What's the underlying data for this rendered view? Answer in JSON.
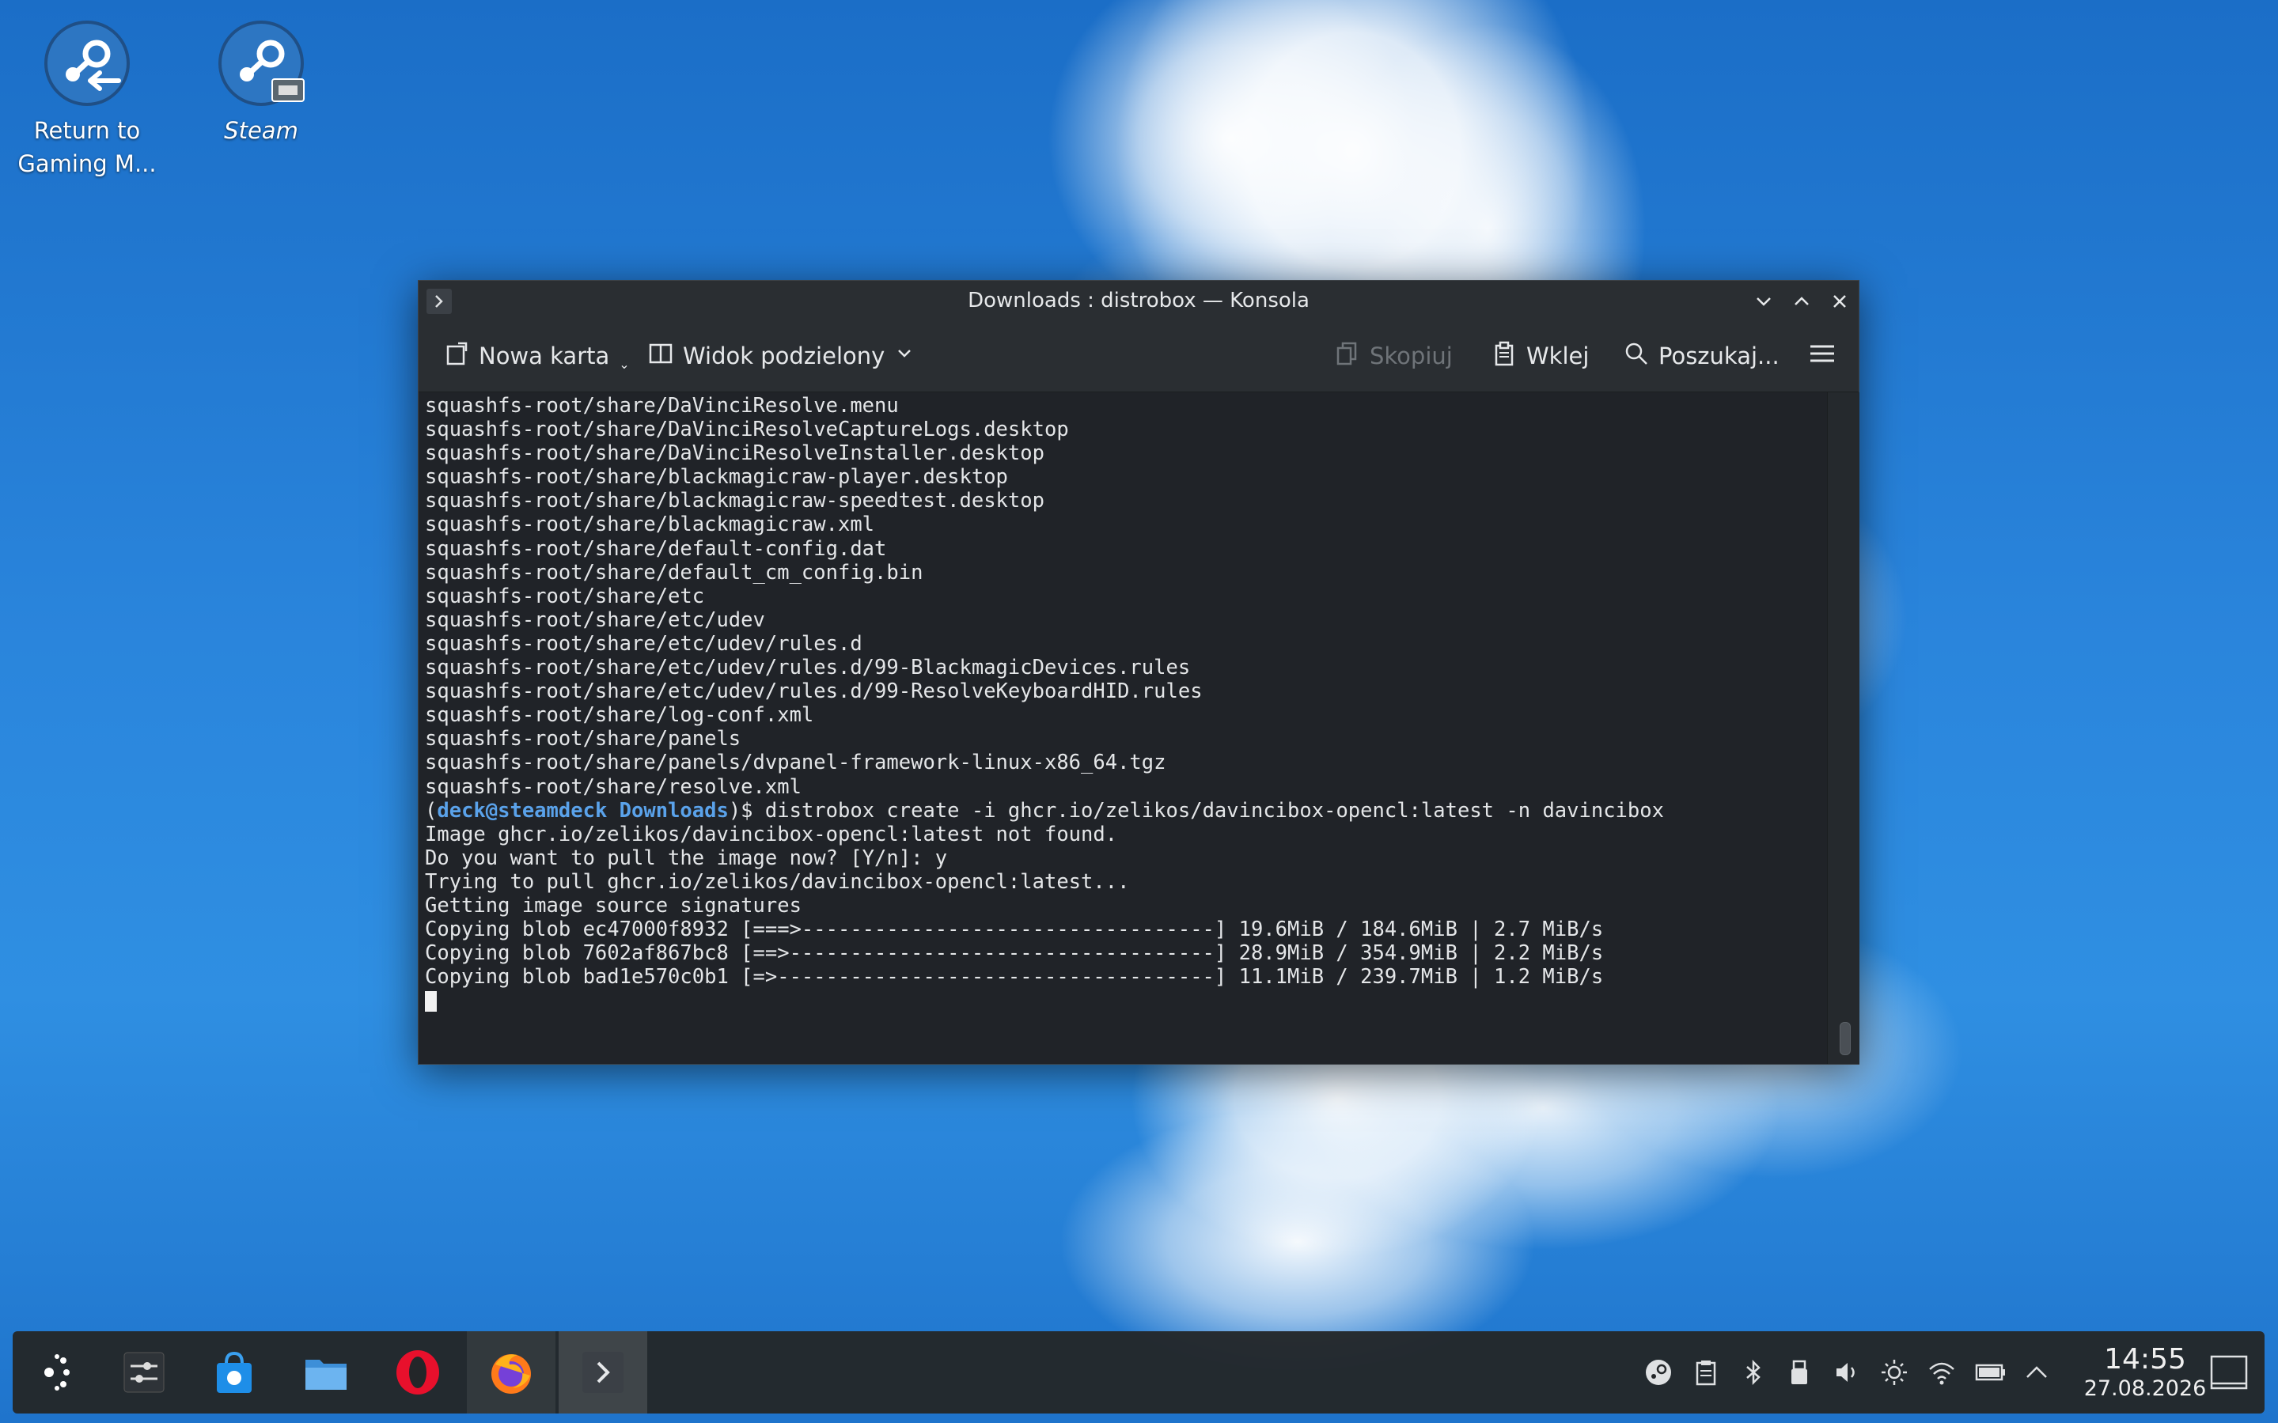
{
  "desktop": {
    "icons": [
      {
        "label": "Return to\nGaming M..."
      },
      {
        "label": "Steam"
      }
    ]
  },
  "window": {
    "title": "Downloads : distrobox — Konsola",
    "toolbar": {
      "new_tab": "Nowa karta",
      "split_view": "Widok podzielony",
      "copy": "Skopiuj",
      "paste": "Wklej",
      "search": "Poszukaj..."
    },
    "terminal": {
      "lines": [
        "squashfs-root/share/DaVinciResolve.menu",
        "squashfs-root/share/DaVinciResolveCaptureLogs.desktop",
        "squashfs-root/share/DaVinciResolveInstaller.desktop",
        "squashfs-root/share/blackmagicraw-player.desktop",
        "squashfs-root/share/blackmagicraw-speedtest.desktop",
        "squashfs-root/share/blackmagicraw.xml",
        "squashfs-root/share/default-config.dat",
        "squashfs-root/share/default_cm_config.bin",
        "squashfs-root/share/etc",
        "squashfs-root/share/etc/udev",
        "squashfs-root/share/etc/udev/rules.d",
        "squashfs-root/share/etc/udev/rules.d/99-BlackmagicDevices.rules",
        "squashfs-root/share/etc/udev/rules.d/99-ResolveKeyboardHID.rules",
        "squashfs-root/share/log-conf.xml",
        "squashfs-root/share/panels",
        "squashfs-root/share/panels/dvpanel-framework-linux-x86_64.tgz",
        "squashfs-root/share/resolve.xml"
      ],
      "prompt": {
        "open": "(",
        "user": "deck@steamdeck",
        "dir": "Downloads",
        "close": ")$ ",
        "command": "distrobox create -i ghcr.io/zelikos/davincibox-opencl:latest -n davincibox"
      },
      "output": [
        "Image ghcr.io/zelikos/davincibox-opencl:latest not found.",
        "Do you want to pull the image now? [Y/n]: y",
        "Trying to pull ghcr.io/zelikos/davincibox-opencl:latest...",
        "Getting image source signatures",
        "Copying blob ec47000f8932 [===>----------------------------------] 19.6MiB / 184.6MiB | 2.7 MiB/s",
        "Copying blob 7602af867bc8 [==>-----------------------------------] 28.9MiB / 354.9MiB | 2.2 MiB/s",
        "Copying blob bad1e570c0b1 [=>------------------------------------] 11.1MiB / 239.7MiB | 1.2 MiB/s"
      ]
    }
  },
  "taskbar": {
    "clock": {
      "time": "14:55",
      "date": "27.08.2026"
    }
  }
}
